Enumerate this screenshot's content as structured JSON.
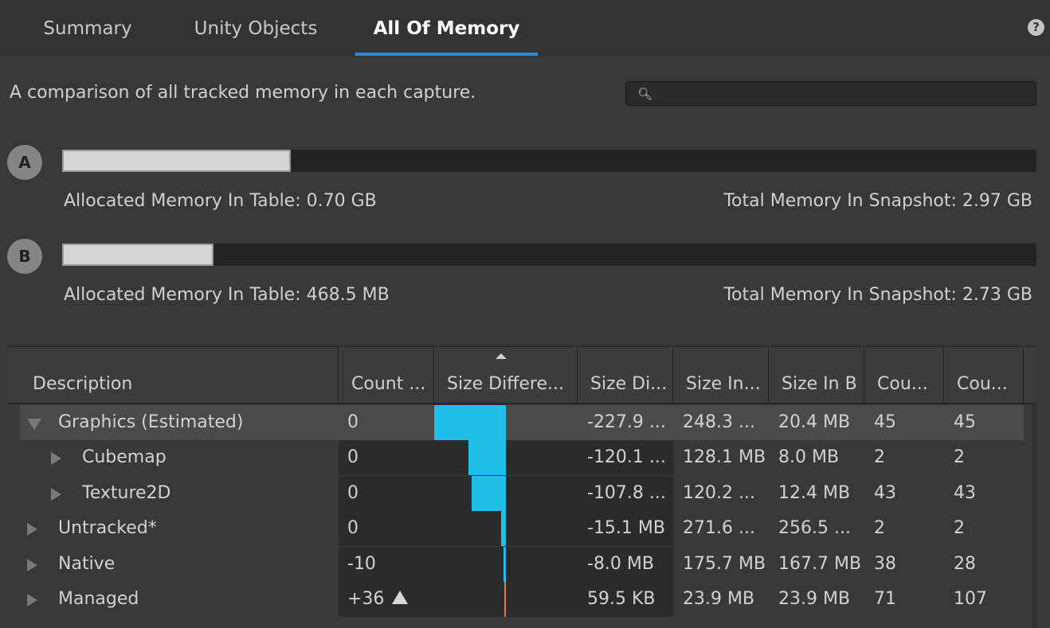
{
  "tabs": [
    {
      "label": "Summary"
    },
    {
      "label": "Unity Objects"
    },
    {
      "label": "All Of Memory"
    }
  ],
  "description": "A comparison of all tracked memory in each capture.",
  "search": {
    "value": "",
    "placeholder": ""
  },
  "snapshots": [
    {
      "badge": "A",
      "allocated": "Allocated Memory In Table: 0.70 GB",
      "total": "Total Memory In Snapshot: 2.97 GB",
      "fill_fraction": 0.235
    },
    {
      "badge": "B",
      "allocated": "Allocated Memory In Table: 468.5 MB",
      "total": "Total Memory In Snapshot: 2.73 GB",
      "fill_fraction": 0.155
    }
  ],
  "table": {
    "columns": [
      "Description",
      "Count ...",
      "Size Differe...",
      "Size Di...",
      "Size In...",
      "Size In B",
      "Cou...",
      "Cou..."
    ],
    "rows": [
      {
        "description": "Graphics (Estimated)",
        "count_diff": "0",
        "size_diff_fraction": 1.0,
        "size_diff": "-227.9 ...",
        "size_a": "248.3 ...",
        "size_b": "20.4 MB",
        "count_a": "45",
        "count_b": "45",
        "level": 0,
        "expanded": true,
        "selected": true
      },
      {
        "description": "Cubemap",
        "count_diff": "0",
        "size_diff_fraction": 0.527,
        "size_diff": "-120.1 ...",
        "size_a": "128.1 MB",
        "size_b": "8.0 MB",
        "count_a": "2",
        "count_b": "2",
        "level": 1,
        "expanded": false,
        "selected": false
      },
      {
        "description": "Texture2D",
        "count_diff": "0",
        "size_diff_fraction": 0.473,
        "size_diff": "-107.8 ...",
        "size_a": "120.2 ...",
        "size_b": "12.4 MB",
        "count_a": "43",
        "count_b": "43",
        "level": 1,
        "expanded": false,
        "selected": false
      },
      {
        "description": "Untracked*",
        "count_diff": "0",
        "size_diff_fraction": 0.066,
        "size_diff": "-15.1 MB",
        "size_a": "271.6 ...",
        "size_b": "256.5 ...",
        "count_a": "2",
        "count_b": "2",
        "level": 0,
        "expanded": false,
        "selected": false
      },
      {
        "description": "Native",
        "count_diff": "-10",
        "size_diff_fraction": 0.035,
        "size_diff": "-8.0 MB",
        "size_a": "175.7 MB",
        "size_b": "167.7 MB",
        "count_a": "38",
        "count_b": "28",
        "level": 0,
        "expanded": false,
        "selected": false
      },
      {
        "description": "Managed",
        "count_diff": "+36",
        "count_increased": true,
        "size_diff_fraction": 0.0003,
        "size_diff": "59.5 KB",
        "size_a": "23.9 MB",
        "size_b": "23.9 MB",
        "count_a": "71",
        "count_b": "107",
        "level": 0,
        "expanded": false,
        "selected": false
      }
    ]
  },
  "colors": {
    "tab_underline": "#2f8ad6",
    "diff_decrease": "#1fc0e8",
    "diff_increase": "#e07a3a"
  }
}
